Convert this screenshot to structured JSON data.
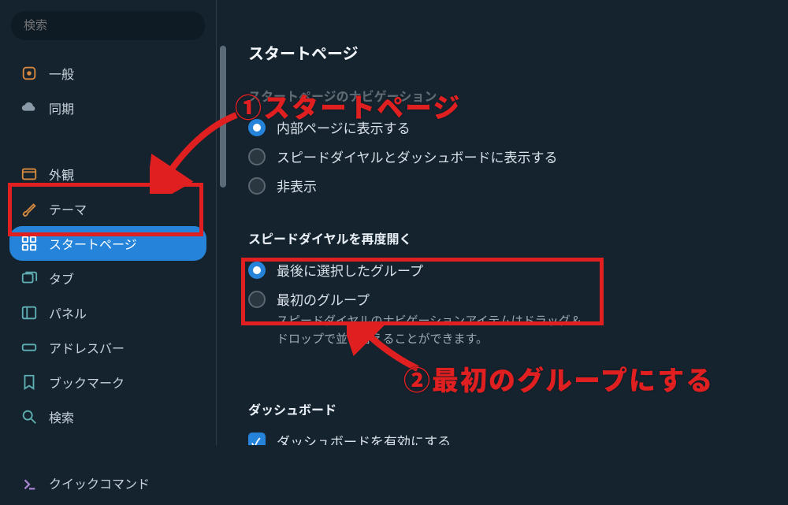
{
  "search": {
    "placeholder": "検索"
  },
  "sidebar": {
    "groups": [
      {
        "items": [
          {
            "label": "一般"
          },
          {
            "label": "同期"
          }
        ]
      },
      {
        "items": [
          {
            "label": "外観"
          },
          {
            "label": "テーマ"
          },
          {
            "label": "スタートページ"
          },
          {
            "label": "タブ"
          },
          {
            "label": "パネル"
          },
          {
            "label": "アドレスバー"
          },
          {
            "label": "ブックマーク"
          },
          {
            "label": "検索"
          }
        ]
      },
      {
        "items": [
          {
            "label": "クイックコマンド"
          }
        ]
      }
    ]
  },
  "main": {
    "title": "スタートページ",
    "nav_section_title": "スタートページのナビゲーション",
    "nav_options": [
      {
        "label": "内部ページに表示する",
        "checked": true
      },
      {
        "label": "スピードダイヤルとダッシュボードに表示する",
        "checked": false
      },
      {
        "label": "非表示",
        "checked": false
      }
    ],
    "reopen_section_title": "スピードダイヤルを再度開く",
    "reopen_options": [
      {
        "label": "最後に選択したグループ",
        "checked": true,
        "desc": ""
      },
      {
        "label": "最初のグループ",
        "checked": false,
        "desc": "スピードダイヤルのナビゲーションアイテムはドラッグ＆ドロップで並び替えることができます。"
      }
    ],
    "dashboard_section_title": "ダッシュボード",
    "dashboard_checkbox_label": "ダッシュボードを有効にする"
  },
  "annotations": {
    "label1": "①スタートページ",
    "label2": "②最初のグループにする"
  },
  "colors": {
    "accent": "#2584da",
    "annotation": "#e02020",
    "text_primary": "#d5dde6",
    "text_muted": "#9caab6",
    "bg": "#15232e"
  }
}
